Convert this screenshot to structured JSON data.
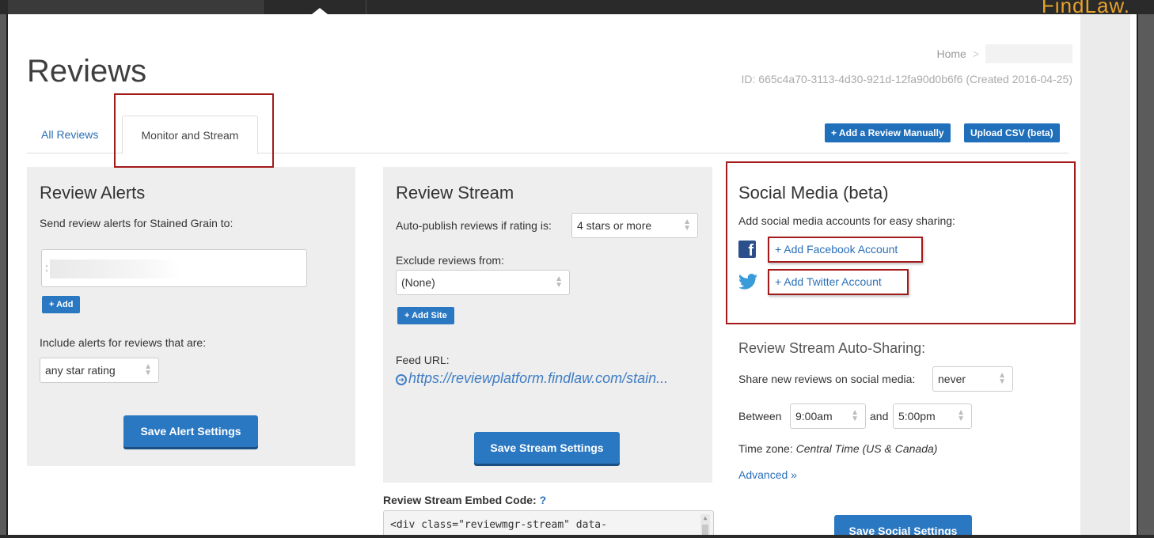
{
  "topbar": {
    "logo": "FindLaw."
  },
  "page": {
    "title": "Reviews",
    "breadcrumb_home": "Home",
    "record_id": "ID: 665c4a70-3113-4d30-921d-12fa90d0b6f6 (Created 2016-04-25)"
  },
  "tabs": [
    {
      "label": "All Reviews"
    },
    {
      "label": "Monitor and Stream"
    }
  ],
  "toolbar": {
    "add_review_label": "+ Add a Review Manually",
    "upload_csv_label": "Upload CSV (beta)"
  },
  "alerts": {
    "heading": "Review Alerts",
    "send_label": "Send review alerts for Stained Grain to:",
    "email_value": ":",
    "add_label": "+ Add",
    "include_label": "Include alerts for reviews that are:",
    "rating_selected": "any star rating",
    "save_label": "Save Alert Settings"
  },
  "stream": {
    "heading": "Review Stream",
    "autopublish_label": "Auto-publish reviews if rating is:",
    "autopublish_selected": "4 stars or more",
    "exclude_label": "Exclude reviews from:",
    "exclude_selected": "(None)",
    "add_site_label": "+ Add Site",
    "feed_label": "Feed URL:",
    "feed_url": "https://reviewplatform.findlaw.com/stain...",
    "save_label": "Save Stream Settings",
    "embed_label": "Review Stream Embed Code:",
    "embed_help": "?",
    "embed_code": "<div class=\"reviewmgr-stream\" data-"
  },
  "social": {
    "heading": "Social Media (beta)",
    "desc": "Add social media accounts for easy sharing:",
    "facebook_label": "+ Add Facebook Account",
    "twitter_label": "+ Add Twitter Account",
    "autoshare_heading": "Review Stream Auto-Sharing:",
    "share_label": "Share new reviews on social media:",
    "share_selected": "never",
    "between_label": "Between",
    "start_time": "9:00am",
    "and_label": "and",
    "end_time": "5:00pm",
    "timezone_label": "Time zone:",
    "timezone_value": "Central Time (US & Canada)",
    "advanced_label": "Advanced »",
    "save_label": "Save Social Settings"
  },
  "colors": {
    "primary": "#2b78c2",
    "link": "#2a6fb8",
    "highlight": "#a31a1a",
    "facebook": "#2c4f8c",
    "twitter": "#3a9bd9"
  }
}
